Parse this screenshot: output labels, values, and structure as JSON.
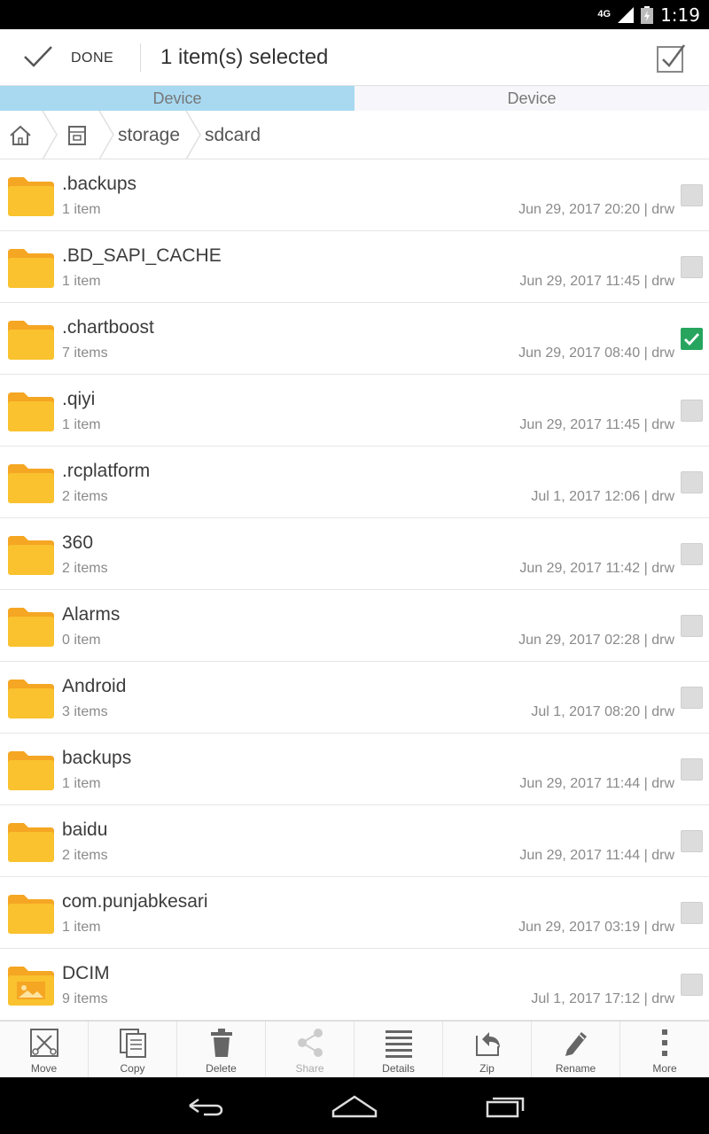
{
  "status_bar": {
    "network": "4G",
    "time": "1:19"
  },
  "action_bar": {
    "done_label": "DONE",
    "title": "1 item(s) selected"
  },
  "tabs": [
    {
      "label": "Device",
      "active": true
    },
    {
      "label": "Device",
      "active": false
    }
  ],
  "breadcrumb": {
    "items": [
      "storage",
      "sdcard"
    ]
  },
  "files": [
    {
      "name": ".backups",
      "count": "1 item",
      "meta": "Jun 29, 2017 20:20 | drw",
      "checked": false
    },
    {
      "name": ".BD_SAPI_CACHE",
      "count": "1 item",
      "meta": "Jun 29, 2017 11:45 | drw",
      "checked": false
    },
    {
      "name": ".chartboost",
      "count": "7 items",
      "meta": "Jun 29, 2017 08:40 | drw",
      "checked": true
    },
    {
      "name": ".qiyi",
      "count": "1 item",
      "meta": "Jun 29, 2017 11:45 | drw",
      "checked": false
    },
    {
      "name": ".rcplatform",
      "count": "2 items",
      "meta": "Jul 1, 2017 12:06 | drw",
      "checked": false
    },
    {
      "name": "360",
      "count": "2 items",
      "meta": "Jun 29, 2017 11:42 | drw",
      "checked": false
    },
    {
      "name": "Alarms",
      "count": "0 item",
      "meta": "Jun 29, 2017 02:28 | drw",
      "checked": false
    },
    {
      "name": "Android",
      "count": "3 items",
      "meta": "Jul 1, 2017 08:20 | drw",
      "checked": false
    },
    {
      "name": "backups",
      "count": "1 item",
      "meta": "Jun 29, 2017 11:44 | drw",
      "checked": false
    },
    {
      "name": "baidu",
      "count": "2 items",
      "meta": "Jun 29, 2017 11:44 | drw",
      "checked": false
    },
    {
      "name": "com.punjabkesari",
      "count": "1 item",
      "meta": "Jun 29, 2017 03:19 | drw",
      "checked": false
    },
    {
      "name": "DCIM",
      "count": "9 items",
      "meta": "Jul 1, 2017 17:12 | drw",
      "checked": false,
      "icon": "image-folder-icon"
    }
  ],
  "toolbar": [
    {
      "label": "Move",
      "icon": "move-icon",
      "enabled": true
    },
    {
      "label": "Copy",
      "icon": "copy-icon",
      "enabled": true
    },
    {
      "label": "Delete",
      "icon": "delete-icon",
      "enabled": true
    },
    {
      "label": "Share",
      "icon": "share-icon",
      "enabled": false
    },
    {
      "label": "Details",
      "icon": "details-icon",
      "enabled": true
    },
    {
      "label": "Zip",
      "icon": "zip-icon",
      "enabled": true
    },
    {
      "label": "Rename",
      "icon": "rename-icon",
      "enabled": true
    },
    {
      "label": "More",
      "icon": "more-icon",
      "enabled": true
    }
  ],
  "colors": {
    "tab_active": "#a8d9f1",
    "folder": "#f9c22e",
    "checkbox_checked": "#27a55f"
  }
}
